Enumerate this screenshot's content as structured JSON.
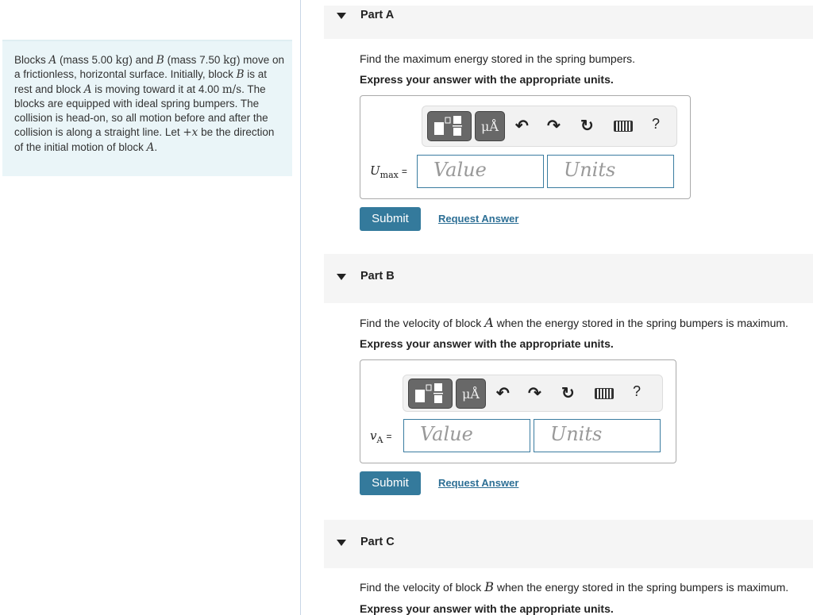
{
  "problem": {
    "segments": [
      "Blocks ",
      "A",
      " (mass 5.00 ",
      "kg",
      ") and ",
      "B",
      " (mass 7.50 ",
      "kg",
      ") move on a frictionless, horizontal surface. Initially, block ",
      "B",
      " is at rest and block ",
      "A",
      " is moving toward it at 4.00 ",
      "m/s",
      ". The blocks are equipped with ideal spring bumpers. The collision is head-on, so all motion before and after the collision is along a straight line. Let ",
      "+x",
      " be the direction of the initial motion of block ",
      "A",
      "."
    ]
  },
  "toolbar": {
    "icons": [
      "templates-icon",
      "units-icon",
      "undo-icon",
      "redo-icon",
      "reset-icon",
      "keyboard-icon",
      "help-icon"
    ],
    "units_label": "μÅ",
    "help_label": "?"
  },
  "parts": [
    {
      "title": "Part A",
      "question_pre": "Find the maximum energy stored in the spring bumpers.",
      "question_var": "",
      "question_post": "",
      "instruction": "Express your answer with the appropriate units.",
      "label_var": "U",
      "label_sub": "max",
      "value_placeholder": "Value",
      "units_placeholder": "Units",
      "submit": "Submit",
      "request": "Request Answer"
    },
    {
      "title": "Part B",
      "question_pre": "Find the velocity of block ",
      "question_var": "A",
      "question_post": " when the energy stored in the spring bumpers is maximum.",
      "instruction": "Express your answer with the appropriate units.",
      "label_var": "v",
      "label_sub": "A",
      "value_placeholder": "Value",
      "units_placeholder": "Units",
      "submit": "Submit",
      "request": "Request Answer"
    },
    {
      "title": "Part C",
      "question_pre": "Find the velocity of block ",
      "question_var": "B",
      "question_post": " when the energy stored in the spring bumpers is maximum.",
      "instruction": "Express your answer with the appropriate units."
    }
  ],
  "colors": {
    "accent": "#347a9c",
    "problem_bg": "#eaf5f8",
    "part_header_bg": "#f5f5f5"
  }
}
